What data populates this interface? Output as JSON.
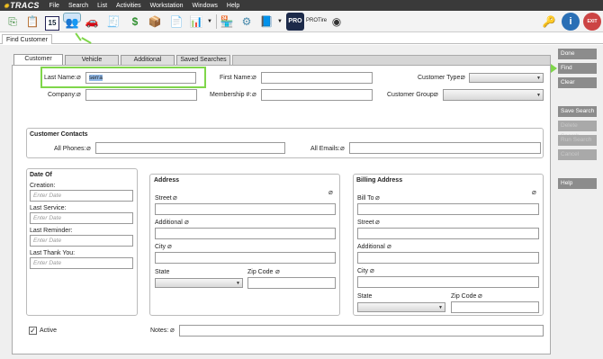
{
  "app": {
    "logo": "TRACS"
  },
  "menu": [
    "File",
    "Search",
    "List",
    "Activities",
    "Workstation",
    "Windows",
    "Help"
  ],
  "toolbar": {
    "calendar_day": "15",
    "pro_label": "PRO",
    "protire_label": "PROTire",
    "exit_label": "EXIT"
  },
  "doc_tab": "Find Customer",
  "tabs": [
    "Customer",
    "Vehicle",
    "Additional",
    "Saved Searches"
  ],
  "side_buttons": {
    "done": "Done",
    "find": "Find",
    "clear": "Clear",
    "save_search": "Save Search",
    "disabled1": "Delete Search",
    "disabled2": "Run Search",
    "disabled3": "Cancel",
    "help": "Help"
  },
  "fields": {
    "last_name_label": "Last Name:",
    "last_name_value": "serra",
    "first_name_label": "First Name:",
    "customer_type_label": "Customer Type:",
    "company_label": "Company:",
    "membership_label": "Membership #:",
    "customer_group_label": "Customer Group:"
  },
  "contacts": {
    "title": "Customer Contacts",
    "phones_label": "All Phones:",
    "emails_label": "All Emails:"
  },
  "date_of": {
    "title": "Date Of",
    "creation": "Creation:",
    "last_service": "Last Service:",
    "last_reminder": "Last Reminder:",
    "last_thank_you": "Last Thank You:",
    "placeholder": "Enter Date"
  },
  "address": {
    "title": "Address",
    "street": "Street",
    "additional": "Additional",
    "city": "City",
    "state": "State",
    "zip": "Zip Code"
  },
  "billing": {
    "title": "Billing Address",
    "bill_to": "Bill To",
    "street": "Street",
    "additional": "Additional",
    "city": "City",
    "state": "State",
    "zip": "Zip Code"
  },
  "active_label": "Active",
  "notes_label": "Notes:"
}
